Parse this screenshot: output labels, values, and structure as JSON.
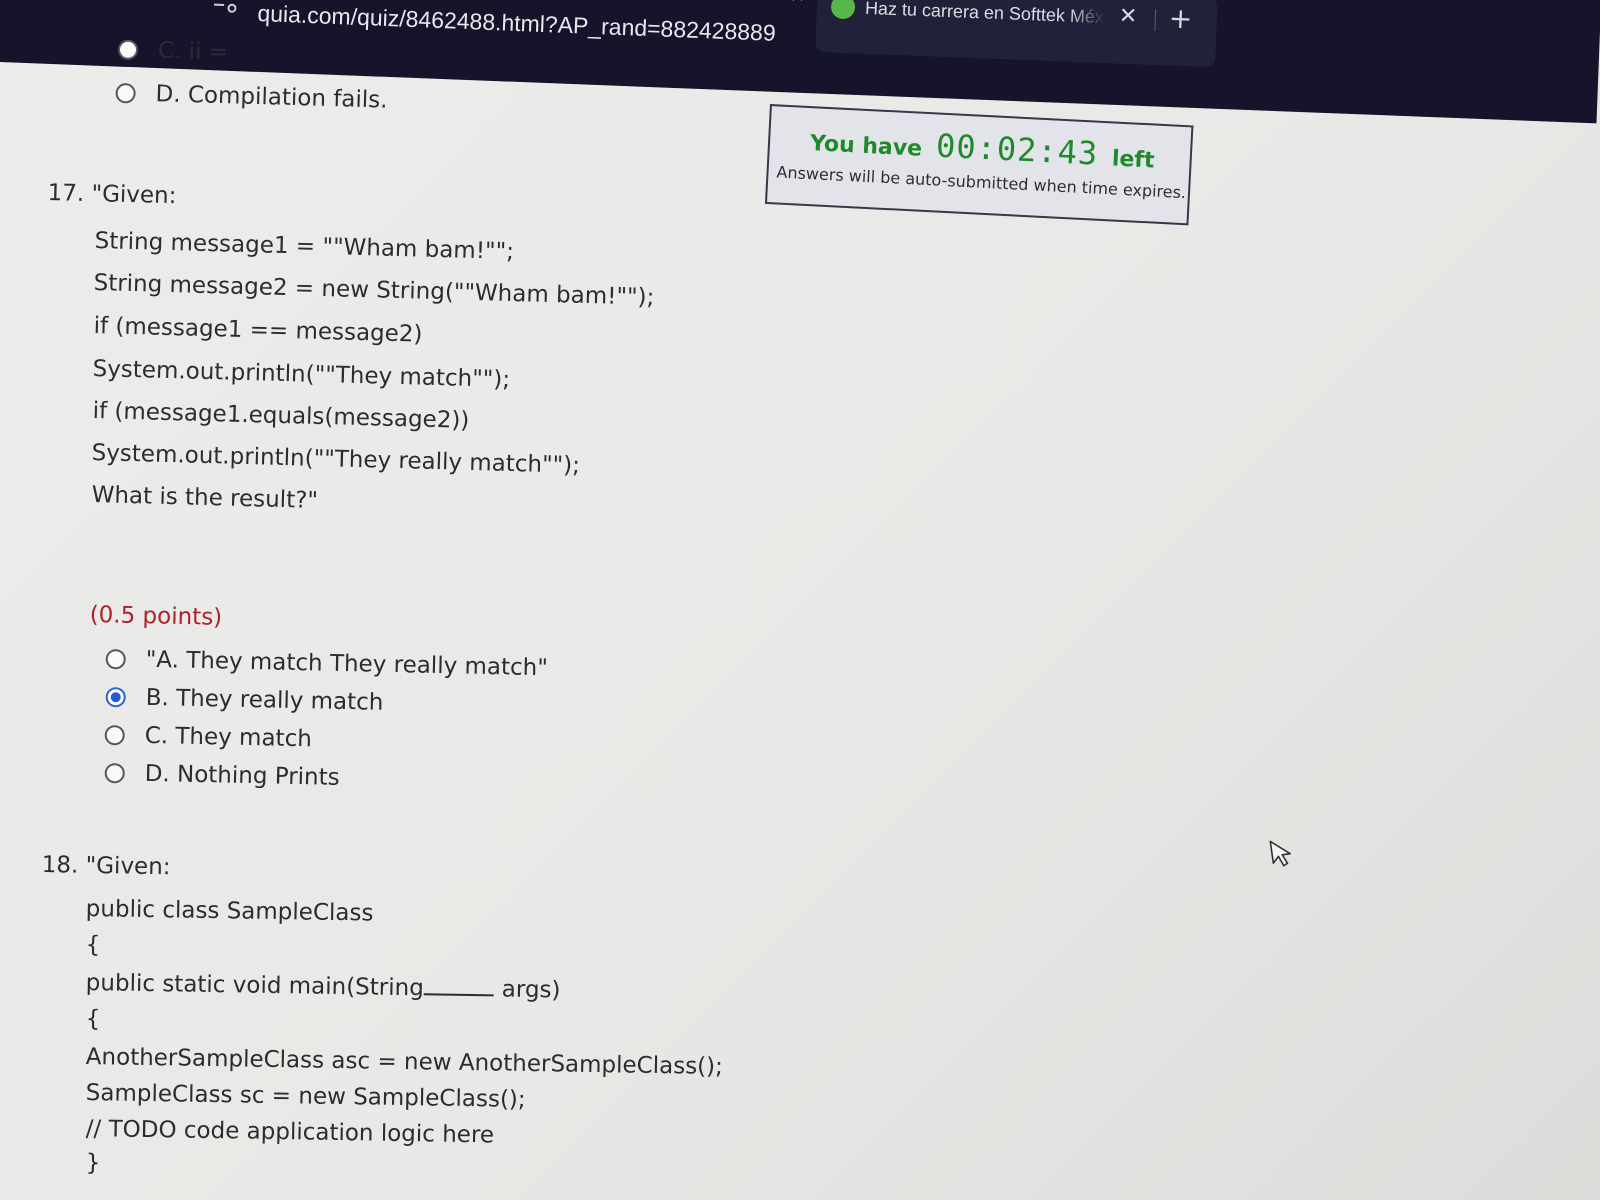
{
  "browser": {
    "url": "quia.com/quiz/8462488.html?AP_rand=882428889",
    "tab_title": "Haz tu carrera en Softtek Méxic",
    "tab_favicon": "softtek-leaf-icon",
    "tab_close_label": "✕",
    "new_tab_label": "+",
    "other_tab_close_label": "✕"
  },
  "timer": {
    "prefix": "You have",
    "time": "00:02:43",
    "suffix": "left",
    "note": "Answers will be auto-submitted when time expires.",
    "color": "#1e8a2a"
  },
  "question_16_tail": {
    "options": [
      {
        "label": "C. ii =",
        "selected": false
      },
      {
        "label": "D. Compilation fails.",
        "selected": false
      }
    ]
  },
  "question_17": {
    "number": "17.",
    "intro": "\"Given:",
    "code": [
      "String message1 = \"\"Wham bam!\"\";",
      "String message2 = new String(\"\"Wham bam!\"\");",
      "if (message1 == message2)",
      "System.out.println(\"\"They match\"\");",
      "if (message1.equals(message2))",
      "System.out.println(\"\"They really match\"\");",
      "What is the result?\""
    ],
    "points": "(0.5 points)",
    "options": [
      {
        "label": "\"A. They match They really match\"",
        "selected": false
      },
      {
        "label": "B. They really match",
        "selected": true
      },
      {
        "label": "C. They match",
        "selected": false
      },
      {
        "label": "D. Nothing Prints",
        "selected": false
      }
    ]
  },
  "question_18": {
    "number": "18.",
    "intro": "\"Given:",
    "code": [
      "public class SampleClass",
      "{",
      "public static void main(String",
      "args)",
      "{",
      "AnotherSampleClass asc = new AnotherSampleClass();",
      "SampleClass sc = new SampleClass();",
      "// TODO code application logic here",
      "}"
    ]
  },
  "colors": {
    "points_red": "#b0202a",
    "radio_selected_blue": "#2459cf",
    "chrome_dark": "#15142a"
  }
}
